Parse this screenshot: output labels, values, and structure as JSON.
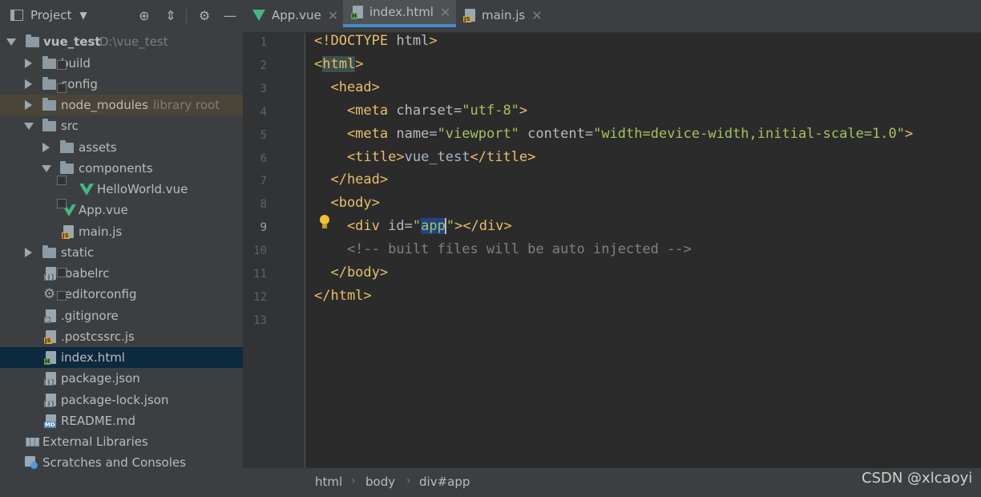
{
  "sidebar": {
    "header": {
      "title": "Project"
    },
    "tree": [
      {
        "label": "vue_test",
        "hint": "D:\\vue_test",
        "type": "folder",
        "expanded": true
      },
      {
        "label": "build",
        "type": "folder"
      },
      {
        "label": "config",
        "type": "folder"
      },
      {
        "label": "node_modules",
        "hint": "library root",
        "type": "folder"
      },
      {
        "label": "src",
        "type": "folder",
        "expanded": true
      },
      {
        "label": "assets",
        "type": "folder"
      },
      {
        "label": "components",
        "type": "folder",
        "expanded": true
      },
      {
        "label": "HelloWorld.vue",
        "type": "vue"
      },
      {
        "label": "App.vue",
        "type": "vue"
      },
      {
        "label": "main.js",
        "type": "js"
      },
      {
        "label": "static",
        "type": "folder"
      },
      {
        "label": ".babelrc",
        "type": "config"
      },
      {
        "label": ".editorconfig",
        "type": "gear"
      },
      {
        "label": ".gitignore",
        "type": "config"
      },
      {
        "label": ".postcssrc.js",
        "type": "js"
      },
      {
        "label": "index.html",
        "type": "html",
        "selected": true
      },
      {
        "label": "package.json",
        "type": "config"
      },
      {
        "label": "package-lock.json",
        "type": "config"
      },
      {
        "label": "README.md",
        "type": "md"
      },
      {
        "label": "External Libraries",
        "type": "libraries"
      },
      {
        "label": "Scratches and Consoles",
        "type": "scratches"
      }
    ]
  },
  "tabs": [
    {
      "label": "App.vue",
      "icon": "vue-icon",
      "active": false
    },
    {
      "label": "index.html",
      "icon": "html-file-icon",
      "active": true
    },
    {
      "label": "main.js",
      "icon": "js-file-icon",
      "active": false
    }
  ],
  "editor": {
    "line_numbers": [
      "1",
      "2",
      "3",
      "4",
      "5",
      "6",
      "7",
      "8",
      "9",
      "10",
      "11",
      "12",
      "13"
    ],
    "current_line": "9",
    "lines": [
      [
        {
          "t": "<!DOCTYPE ",
          "c": "tag"
        },
        {
          "t": "html",
          "c": "attr"
        },
        {
          "t": ">",
          "c": "tag"
        }
      ],
      [
        {
          "t": "<",
          "c": "tag"
        },
        {
          "t": "html",
          "c": "hl-tag"
        },
        {
          "t": ">",
          "c": "tag"
        }
      ],
      [
        {
          "t": "  <head>",
          "c": "tag"
        }
      ],
      [
        {
          "t": "    <meta ",
          "c": "tag"
        },
        {
          "t": "charset",
          "c": "attr"
        },
        {
          "t": "=",
          "c": "text"
        },
        {
          "t": "\"utf-8\"",
          "c": "str"
        },
        {
          "t": ">",
          "c": "tag"
        }
      ],
      [
        {
          "t": "    <meta ",
          "c": "tag"
        },
        {
          "t": "name",
          "c": "attr"
        },
        {
          "t": "=",
          "c": "text"
        },
        {
          "t": "\"viewport\"",
          "c": "str"
        },
        {
          "t": " ",
          "c": "text"
        },
        {
          "t": "content",
          "c": "attr"
        },
        {
          "t": "=",
          "c": "text"
        },
        {
          "t": "\"width=device-width,initial-scale=1.0\"",
          "c": "str"
        },
        {
          "t": ">",
          "c": "tag"
        }
      ],
      [
        {
          "t": "    <title>",
          "c": "tag"
        },
        {
          "t": "vue_test",
          "c": "text"
        },
        {
          "t": "</title>",
          "c": "tag"
        }
      ],
      [
        {
          "t": "  </head>",
          "c": "tag"
        }
      ],
      [
        {
          "t": "  <body>",
          "c": "tag"
        }
      ],
      [
        {
          "t": "    <div ",
          "c": "tag"
        },
        {
          "t": "id",
          "c": "attr"
        },
        {
          "t": "=",
          "c": "text"
        },
        {
          "t": "\"",
          "c": "str"
        },
        {
          "t": "app",
          "c": "sel-str"
        },
        {
          "t": "\"",
          "c": "str"
        },
        {
          "t": "></div>",
          "c": "tag"
        }
      ],
      [
        {
          "t": "    <!-- built files will be auto injected -->",
          "c": "comment"
        }
      ],
      [
        {
          "t": "  </body>",
          "c": "tag"
        }
      ],
      [
        {
          "t": "</html>",
          "c": "tag"
        }
      ],
      []
    ]
  },
  "breadcrumb": [
    "html",
    "body",
    "div#app"
  ],
  "watermark": "CSDN @xlcaoyi",
  "colors": {
    "accent": "#4a88c7",
    "selection": "#214283",
    "tag": "#e8bf6a",
    "string": "#a5c25c",
    "comment": "#808080"
  }
}
